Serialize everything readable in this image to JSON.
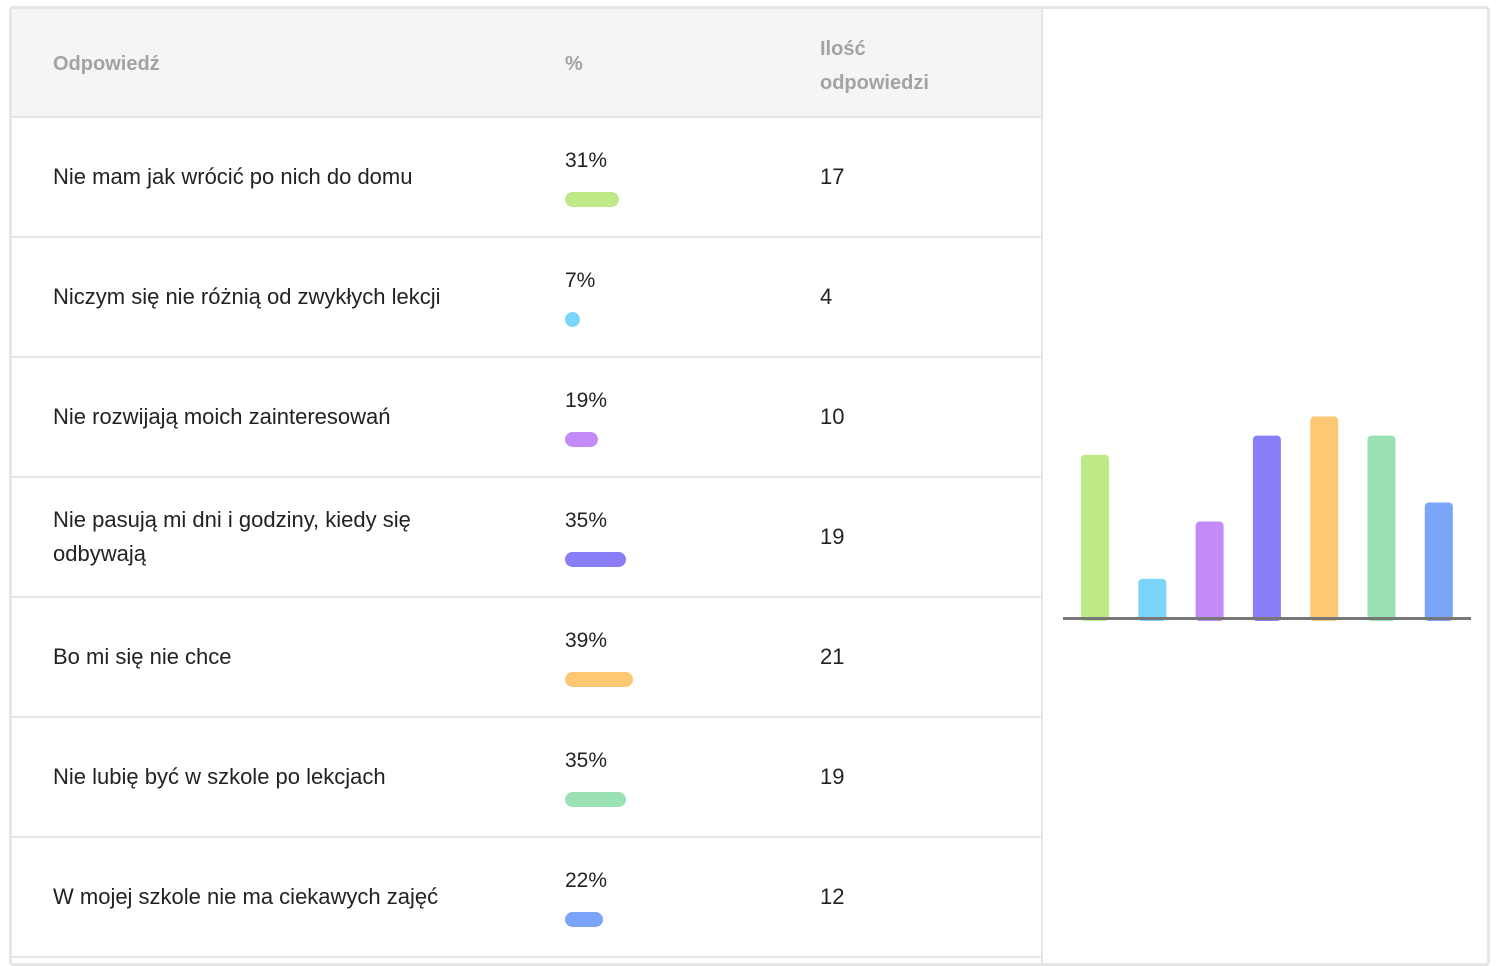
{
  "table": {
    "headers": {
      "answer": "Odpowiedź",
      "percent": "%",
      "count": "Ilość odpowiedzi"
    },
    "rows": [
      {
        "answer": "Nie mam jak wrócić po nich do domu",
        "percent": "31%",
        "percent_value": 31,
        "count": "17",
        "color": "#bde986"
      },
      {
        "answer": "Niczym się nie różnią od zwykłych lekcji",
        "percent": "7%",
        "percent_value": 7,
        "count": "4",
        "color": "#7ad5f9"
      },
      {
        "answer": "Nie rozwijają moich zainteresowań",
        "percent": "19%",
        "percent_value": 19,
        "count": "10",
        "color": "#c48af7"
      },
      {
        "answer": "Nie pasują mi dni i godziny, kiedy się odbywają",
        "percent": "35%",
        "percent_value": 35,
        "count": "19",
        "color": "#8a7ef8"
      },
      {
        "answer": "Bo mi się nie chce",
        "percent": "39%",
        "percent_value": 39,
        "count": "21",
        "color": "#fdc874"
      },
      {
        "answer": "Nie lubię być w szkole po lekcjach",
        "percent": "35%",
        "percent_value": 35,
        "count": "19",
        "color": "#9ae1b3"
      },
      {
        "answer": "W mojej szkole nie ma ciekawych zajęć",
        "percent": "22%",
        "percent_value": 22,
        "count": "12",
        "color": "#7aa5f9"
      }
    ]
  },
  "chart_data": {
    "type": "bar",
    "categories": [
      "Nie mam jak wrócić po nich do domu",
      "Niczym się nie różnią od zwykłych lekcji",
      "Nie rozwijają moich zainteresowań",
      "Nie pasują mi dni i godziny, kiedy się odbywają",
      "Bo mi się nie chce",
      "Nie lubię być w szkole po lekcjach",
      "W mojej szkole nie ma ciekawych zajęć"
    ],
    "values": [
      17,
      4,
      10,
      19,
      21,
      19,
      12
    ],
    "colors": [
      "#bde986",
      "#7ad5f9",
      "#c48af7",
      "#8a7ef8",
      "#fdc874",
      "#9ae1b3",
      "#7aa5f9"
    ],
    "ylim": [
      0,
      22
    ],
    "grid": false,
    "axis_color": "#777777"
  }
}
